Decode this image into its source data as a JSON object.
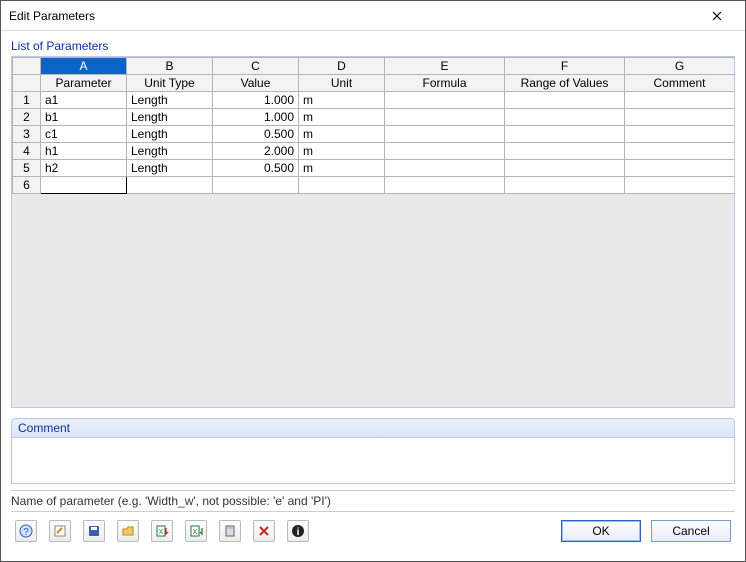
{
  "window": {
    "title": "Edit Parameters"
  },
  "sections": {
    "list_label": "List of Parameters",
    "comment_label": "Comment"
  },
  "columns": {
    "letters": {
      "A": "A",
      "B": "B",
      "C": "C",
      "D": "D",
      "E": "E",
      "F": "F",
      "G": "G"
    },
    "names": {
      "parameter": "Parameter",
      "unit_type": "Unit Type",
      "value": "Value",
      "unit": "Unit",
      "formula": "Formula",
      "range": "Range of Values",
      "comment": "Comment"
    }
  },
  "rows": [
    {
      "n": "1",
      "parameter": "a1",
      "unit_type": "Length",
      "value": "1.000",
      "unit": "m",
      "formula": "",
      "range": "",
      "comment": ""
    },
    {
      "n": "2",
      "parameter": "b1",
      "unit_type": "Length",
      "value": "1.000",
      "unit": "m",
      "formula": "",
      "range": "",
      "comment": ""
    },
    {
      "n": "3",
      "parameter": "c1",
      "unit_type": "Length",
      "value": "0.500",
      "unit": "m",
      "formula": "",
      "range": "",
      "comment": ""
    },
    {
      "n": "4",
      "parameter": "h1",
      "unit_type": "Length",
      "value": "2.000",
      "unit": "m",
      "formula": "",
      "range": "",
      "comment": ""
    },
    {
      "n": "5",
      "parameter": "h2",
      "unit_type": "Length",
      "value": "0.500",
      "unit": "m",
      "formula": "",
      "range": "",
      "comment": ""
    }
  ],
  "editing_row": "6",
  "hint": "Name of parameter (e.g. 'Width_w', not possible: 'e' and 'PI')",
  "buttons": {
    "ok": "OK",
    "cancel": "Cancel"
  },
  "icons": {
    "help": "help-icon",
    "edit": "edit-icon",
    "save": "save-icon",
    "open": "open-icon",
    "excel_import": "excel-import-icon",
    "excel_export": "excel-export-icon",
    "calc": "calculator-icon",
    "delete": "delete-icon",
    "info": "info-icon"
  }
}
